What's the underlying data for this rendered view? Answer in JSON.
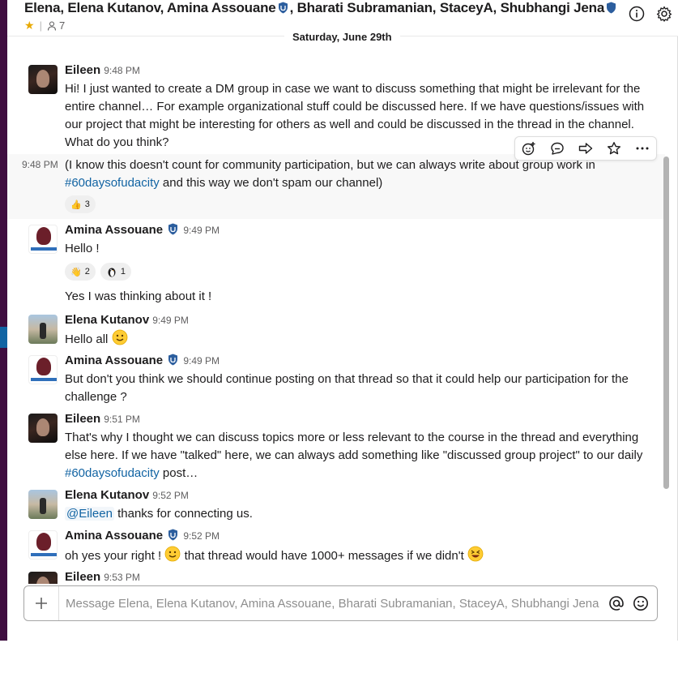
{
  "header": {
    "title_first": "Elena,",
    "title_members_a": "Elena Kutanov, Amina Assouane",
    "title_members_b": ", Bharati Subramanian, StaceyA, Shubhangi Jena",
    "member_count": "7",
    "info_icon": "info-icon",
    "settings_icon": "gear-icon"
  },
  "date_divider": "Saturday, June 29th",
  "messages": [
    {
      "author": "Eileen",
      "time": "9:48 PM",
      "text": "Hi! I just wanted to create a DM group in case we want to discuss something that might be irrelevant for the entire channel… For example organizational stuff could be discussed here. If we have questions/issues with our project that might be interesting for others as well and could be discussed in the thread in the channel. What do you think?"
    },
    {
      "gutter_time": "9:48 PM",
      "text_a": "(I know this doesn't count for community participation, but we can always write about group work in ",
      "link": "#60daysofudacity",
      "text_b": " and this way we don't spam our channel)",
      "reactions": [
        {
          "emoji": "👍",
          "count": "3"
        }
      ]
    },
    {
      "author": "Amina Assouane",
      "time": "9:49 PM",
      "text": "Hello !",
      "reactions": [
        {
          "emoji": "👋",
          "count": "2"
        },
        {
          "emoji": "penguin",
          "count": "1"
        }
      ],
      "text2": "Yes I was thinking about it !"
    },
    {
      "author": "Elena Kutanov",
      "time": "9:49 PM",
      "text": "Hello all"
    },
    {
      "author": "Amina Assouane",
      "time": "9:49 PM",
      "text": "But don't you think we should continue posting on that thread so that it could help our participation for the challenge ?"
    },
    {
      "author": "Eileen",
      "time": "9:51 PM",
      "text_a": "That's why I thought we can discuss topics more or less relevant to the course in the thread and everything else here. If we have \"talked\" here, we can always add something like \"discussed group project\" to our daily ",
      "link": "#60daysofudacity",
      "text_b": " post…"
    },
    {
      "author": "Elena Kutanov",
      "time": "9:52 PM",
      "mention": "@Eileen",
      "text": " thanks for connecting us."
    },
    {
      "author": "Amina Assouane",
      "time": "9:52 PM",
      "text_a": "oh yes your right ! ",
      "text_b": "  that thread would have 1000+ messages if we didn't "
    },
    {
      "author": "Eileen",
      "time": "9:53 PM"
    }
  ],
  "composer": {
    "placeholder": "Message Elena, Elena Kutanov, Amina Assouane, Bharati Subramanian, StaceyA, Shubhangi Jena"
  },
  "colors": {
    "sidebar": "#3f0e40",
    "link": "#1264a3",
    "star": "#e8a900"
  }
}
